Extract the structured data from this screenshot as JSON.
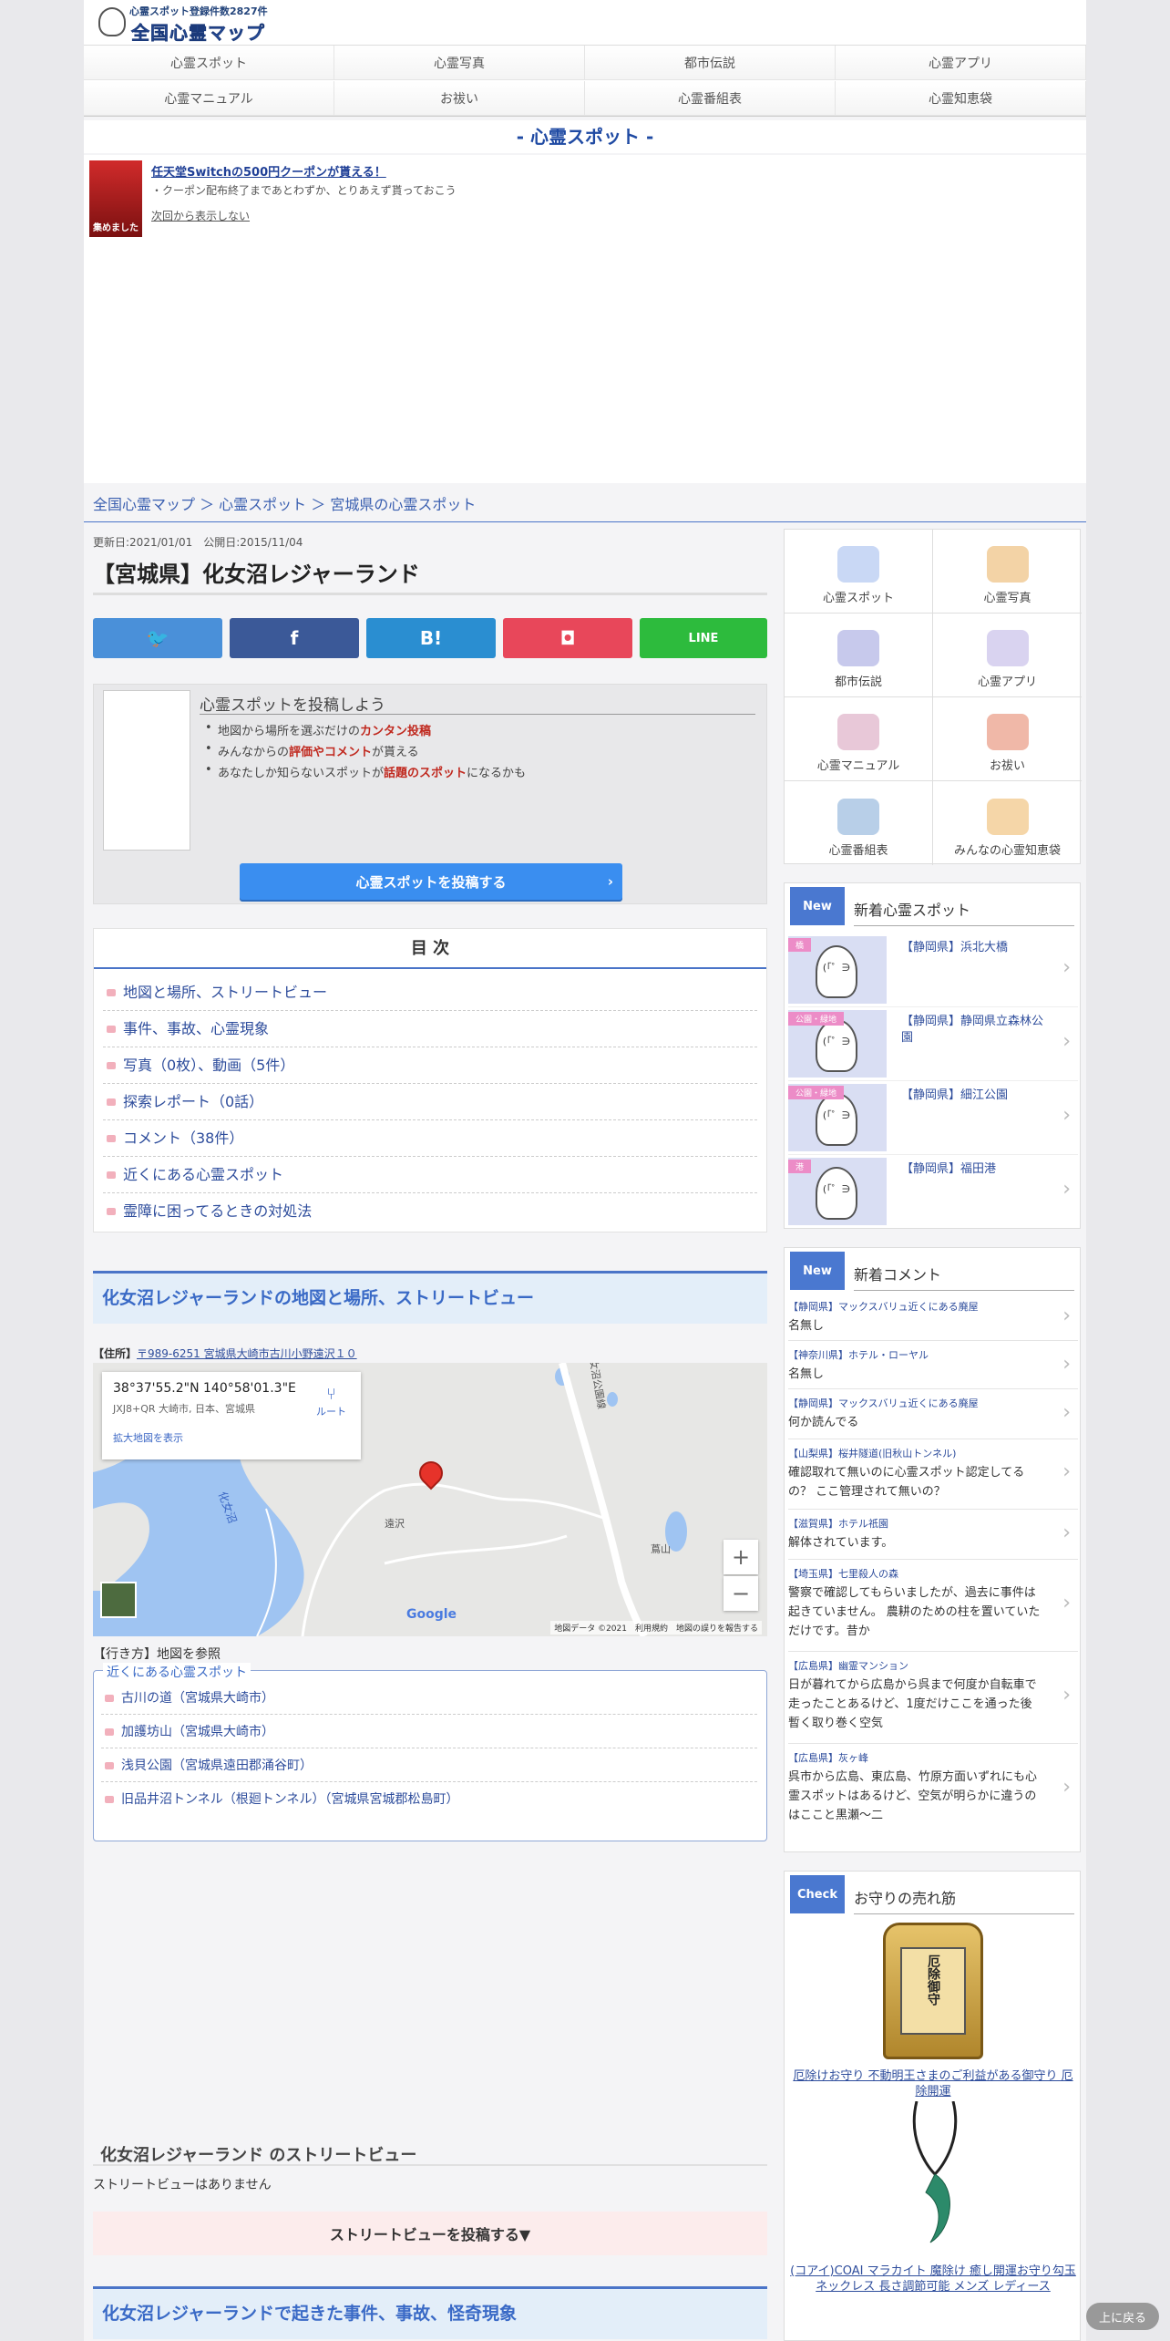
{
  "header": {
    "logo_sub": "心霊スポット登録件数2827件",
    "logo_main": "全国心霊マップ"
  },
  "gnav": [
    "心霊スポット",
    "心霊写真",
    "都市伝説",
    "心霊アプリ",
    "心霊マニュアル",
    "お祓い",
    "心霊番組表",
    "心霊知恵袋"
  ],
  "section_title": "- 心霊スポット -",
  "ad": {
    "thumb_text": "集めました",
    "title": "任天堂Switchの500円クーポンが貰える！",
    "desc": "・クーポン配布終了まであとわずか、とりあえず貰っておこう",
    "hide": "次回から表示しない"
  },
  "breadcrumb": "全国心霊マップ ＞ 心霊スポット ＞ 宮城県の心霊スポット",
  "article": {
    "dates": "更新日:2021/01/01　公開日:2015/11/04",
    "title": "【宮城県】化女沼レジャーランド"
  },
  "share": [
    {
      "name": "twitter",
      "label": "🐦",
      "color": "#4a90d9"
    },
    {
      "name": "facebook",
      "label": "f",
      "color": "#3b5998"
    },
    {
      "name": "hatena",
      "label": "B!",
      "color": "#2a8ed1"
    },
    {
      "name": "pocket",
      "label": "◘",
      "color": "#e8475a"
    },
    {
      "name": "line",
      "label": "LINE",
      "color": "#2dbb3d"
    }
  ],
  "post": {
    "heading": "心霊スポットを投稿しよう",
    "li1_pre": "地図から場所を選ぶだけの",
    "li1_red": "カンタン投稿",
    "li2_pre": "みんなからの",
    "li2_red": "評価やコメント",
    "li2_post": "が貰える",
    "li3_pre": "あなたしか知らないスポットが",
    "li3_red": "話題のスポット",
    "li3_post": "になるかも",
    "button": "心霊スポットを投稿する"
  },
  "toc": {
    "title": "目 次",
    "items": [
      "地図と場所、ストリートビュー",
      "事件、事故、心霊現象",
      "写真（0枚）、動画（5件）",
      "探索レポート（0話）",
      "コメント（38件）",
      "近くにある心霊スポット",
      "霊障に困ってるときの対処法"
    ]
  },
  "map_section": {
    "heading": "化女沼レジャーランドの地図と場所、ストリートビュー",
    "addr_label": "【住所】",
    "addr": "〒989-6251 宮城県大崎市古川小野遠沢１０",
    "coord": "38°37'55.2\"N 140°58'01.3\"E",
    "plus_code": "JXJ8+QR 大崎市, 日本、宮城県",
    "enlarge": "拡大地図を表示",
    "route": "ルート",
    "road_label": "化女沼公園線",
    "lake_label": "化女沼",
    "place1": "遠沢",
    "place2": "蔦山",
    "footer": "地図データ ©2021　利用規約　地図の誤りを報告する",
    "google": "Google"
  },
  "route_note": "【行き方】地図を参照",
  "nearby": {
    "label": "近くにある心霊スポット",
    "items": [
      "古川の道（宮城県大崎市）",
      "加護坊山（宮城県大崎市）",
      "浅貝公園（宮城県遠田郡涌谷町）",
      "旧品井沼トンネル（根廻トンネル）（宮城県宮城郡松島町）"
    ]
  },
  "streetview": {
    "title": "化女沼レジャーランド のストリートビュー",
    "none": "ストリートビューはありません",
    "button": "ストリートビューを投稿する▼"
  },
  "incident_heading": "化女沼レジャーランドで起きた事件、事故、怪奇現象",
  "sidebar": {
    "grid": [
      {
        "label": "心霊スポット",
        "color": "#c9d8f5"
      },
      {
        "label": "心霊写真",
        "color": "#f3d3a6"
      },
      {
        "label": "都市伝説",
        "color": "#c7c9ec"
      },
      {
        "label": "心霊アプリ",
        "color": "#d9d3f0"
      },
      {
        "label": "心霊マニュアル",
        "color": "#e8c8d8"
      },
      {
        "label": "お祓い",
        "color": "#f0b8a8"
      },
      {
        "label": "心霊番組表",
        "color": "#b8cfe8"
      },
      {
        "label": "みんなの心霊知恵袋",
        "color": "#f5d6a8"
      }
    ],
    "new_tag": "New",
    "new_spots_title": "新着心霊スポット",
    "spots": [
      {
        "badge": "橋",
        "name": "【静岡県】浜北大橋"
      },
      {
        "badge": "公園・緑地",
        "name": "【静岡県】静岡県立森林公園"
      },
      {
        "badge": "公園・緑地",
        "name": "【静岡県】細江公園"
      },
      {
        "badge": "港",
        "name": "【静岡県】福田港"
      }
    ],
    "ghost_face": "(「゜∋",
    "new_comments_title": "新着コメント",
    "comments": [
      {
        "title": "【静岡県】マックスバリュ近くにある廃屋",
        "text": "名無し"
      },
      {
        "title": "【神奈川県】ホテル・ローヤル",
        "text": "名無し"
      },
      {
        "title": "【静岡県】マックスバリュ近くにある廃屋",
        "text": "何か読んでる"
      },
      {
        "title": "【山梨県】桜井隧道(旧秋山トンネル)",
        "text": "確認取れて無いのに心霊スポット認定してるの？ ここ管理されて無いの？"
      },
      {
        "title": "【滋賀県】ホテル祇園",
        "text": "解体されています。"
      },
      {
        "title": "【埼玉県】七里殺人の森",
        "text": "警察で確認してもらいましたが、過去に事件は起きていません。 農耕のための柱を置いていただけです。昔か"
      },
      {
        "title": "【広島県】幽霊マンション",
        "text": "日が暮れてから広島から呉まで何度か自転車で走ったことあるけど、1度だけここを通った後暫く取り巻く空気"
      },
      {
        "title": "【広島県】灰ヶ峰",
        "text": "呉市から広島、東広島、竹原方面いずれにも心霊スポットはあるけど、空気が明らかに違うのはここと黒瀬〜二"
      }
    ],
    "check_tag": "Check",
    "check_title": "お守りの売れ筋",
    "omamori_text": "厄除御守",
    "product1": "厄除けお守り 不動明王さまのご利益がある御守り 厄除開運",
    "product2": "(コアイ)COAI マラカイト 魔除け 癒し開運お守り勾玉ネックレス 長さ調節可能 メンズ レディース"
  },
  "top_button": "上に戻る"
}
